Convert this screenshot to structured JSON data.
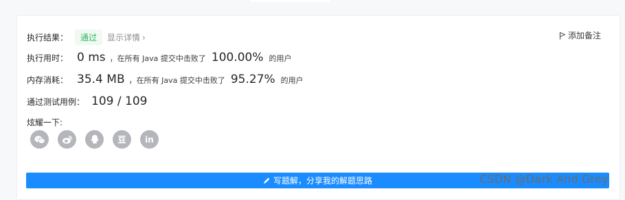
{
  "result": {
    "label": "执行结果：",
    "status": "通过",
    "detail_link": "显示详情",
    "add_note": "添加备注"
  },
  "runtime": {
    "label": "执行用时：",
    "value": "0 ms",
    "prefix": "，在所有 Java 提交中击败了",
    "percent": "100.00%",
    "suffix": "的用户"
  },
  "memory": {
    "label": "内存消耗：",
    "value": "35.4 MB",
    "prefix": "，在所有 Java 提交中击败了",
    "percent": "95.27%",
    "suffix": "的用户"
  },
  "testcases": {
    "label": "通过测试用例：",
    "value": "109 / 109"
  },
  "share": {
    "label": "炫耀一下:",
    "icons": [
      {
        "name": "wechat-icon",
        "glyph": ""
      },
      {
        "name": "weibo-icon",
        "glyph": ""
      },
      {
        "name": "qq-icon",
        "glyph": ""
      },
      {
        "name": "douban-icon",
        "glyph": "豆"
      },
      {
        "name": "linkedin-icon",
        "glyph": "in"
      }
    ]
  },
  "solution_button": "写题解，分享我的解题思路",
  "watermark": "CSDN @Dark And Grey",
  "colors": {
    "accent": "#1a8cff",
    "pass": "#2db55d",
    "icon_gray": "#b4b6bc"
  }
}
